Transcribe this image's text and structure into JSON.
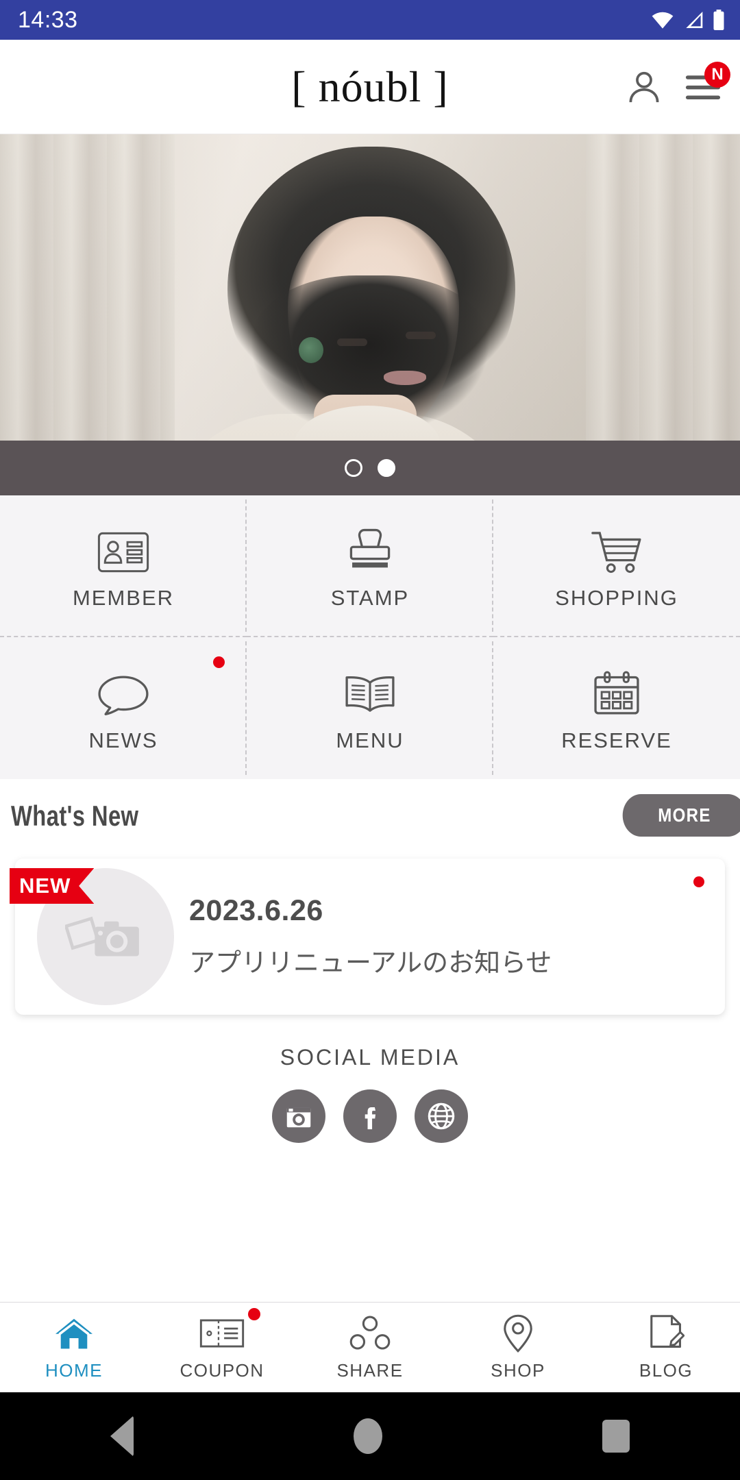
{
  "status_bar": {
    "time": "14:33",
    "icons": [
      "wifi-icon",
      "cellular-signal-icon",
      "battery-icon"
    ]
  },
  "header": {
    "logo": "[ nóubl ]",
    "account_icon": "person-icon",
    "menu_icon": "hamburger-menu-icon",
    "menu_badge": "N"
  },
  "hero": {
    "alt": "woman-portrait-photo",
    "carousel": {
      "total": 2,
      "active_index": 1
    }
  },
  "grid": {
    "items": [
      {
        "label": "MEMBER",
        "icon": "id-card-icon",
        "badge": false
      },
      {
        "label": "STAMP",
        "icon": "rubber-stamp-icon",
        "badge": false
      },
      {
        "label": "SHOPPING",
        "icon": "shopping-cart-icon",
        "badge": false
      },
      {
        "label": "NEWS",
        "icon": "speech-bubble-icon",
        "badge": true
      },
      {
        "label": "MENU",
        "icon": "open-book-icon",
        "badge": false
      },
      {
        "label": "RESERVE",
        "icon": "calendar-icon",
        "badge": false
      }
    ]
  },
  "whats_new": {
    "title": "What's New",
    "more_label": "MORE",
    "items": [
      {
        "badge": "NEW",
        "date": "2023.6.26",
        "title": "アプリリニューアルのお知らせ",
        "thumbnail_icon": "photo-camera-placeholder-icon",
        "unread": true
      }
    ]
  },
  "social_media": {
    "title": "SOCIAL MEDIA",
    "icons": [
      {
        "name": "instagram-icon"
      },
      {
        "name": "facebook-icon"
      },
      {
        "name": "website-globe-icon"
      }
    ]
  },
  "tab_bar": {
    "items": [
      {
        "label": "HOME",
        "icon": "home-icon",
        "active": true,
        "badge": false
      },
      {
        "label": "COUPON",
        "icon": "ticket-icon",
        "active": false,
        "badge": true
      },
      {
        "label": "SHARE",
        "icon": "share-nodes-icon",
        "active": false,
        "badge": false
      },
      {
        "label": "SHOP",
        "icon": "map-pin-icon",
        "active": false,
        "badge": false
      },
      {
        "label": "BLOG",
        "icon": "document-pencil-icon",
        "active": false,
        "badge": false
      }
    ]
  },
  "android_nav": {
    "back": "back-triangle-icon",
    "home": "home-circle-icon",
    "recents": "recents-square-icon"
  },
  "colors": {
    "status_bar": "#3340a0",
    "accent_red": "#e60012",
    "active_tab": "#1e8fc0",
    "grid_bg": "#f5f4f6",
    "dark_gray": "#6d696c"
  }
}
